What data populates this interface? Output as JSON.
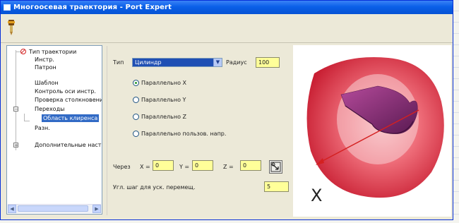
{
  "window": {
    "title": "Многоосевая траектория - Port Expert"
  },
  "toolbar": {
    "tool_icon": "mill-tool-icon"
  },
  "tree": {
    "items": [
      {
        "label": "Тип траектории"
      },
      {
        "label": "Инстр."
      },
      {
        "label": "Патрон"
      },
      {
        "label": "Шаблон"
      },
      {
        "label": "Контроль оси инстр."
      },
      {
        "label": "Проверка столкновени"
      },
      {
        "label": "Переходы"
      },
      {
        "label": "Область клиренса"
      },
      {
        "label": "Разн."
      },
      {
        "label": "Дополнительные настр"
      }
    ]
  },
  "form": {
    "type_label": "Тип",
    "type_value": "Цилиндр",
    "radius_label": "Радиус",
    "radius_value": "100",
    "options": [
      {
        "label": "Параллельно X",
        "selected": true
      },
      {
        "label": "Параллельно Y",
        "selected": false
      },
      {
        "label": "Параллельно Z",
        "selected": false
      },
      {
        "label": "Параллельно пользов. напр.",
        "selected": false
      }
    ],
    "through_label": "Через",
    "x_label": "X =",
    "x_value": "0",
    "y_label": "Y =",
    "y_value": "0",
    "z_label": "Z =",
    "z_value": "0",
    "angle_label": "Угл. шаг для уск. перемещ.",
    "angle_value": "5"
  },
  "view": {
    "axis_label": "X"
  },
  "colors": {
    "title_blue": "#0a5fe8",
    "field_yellow": "#ffff99",
    "cylinder": "#e03848",
    "toolpath": "#8a2a78"
  }
}
